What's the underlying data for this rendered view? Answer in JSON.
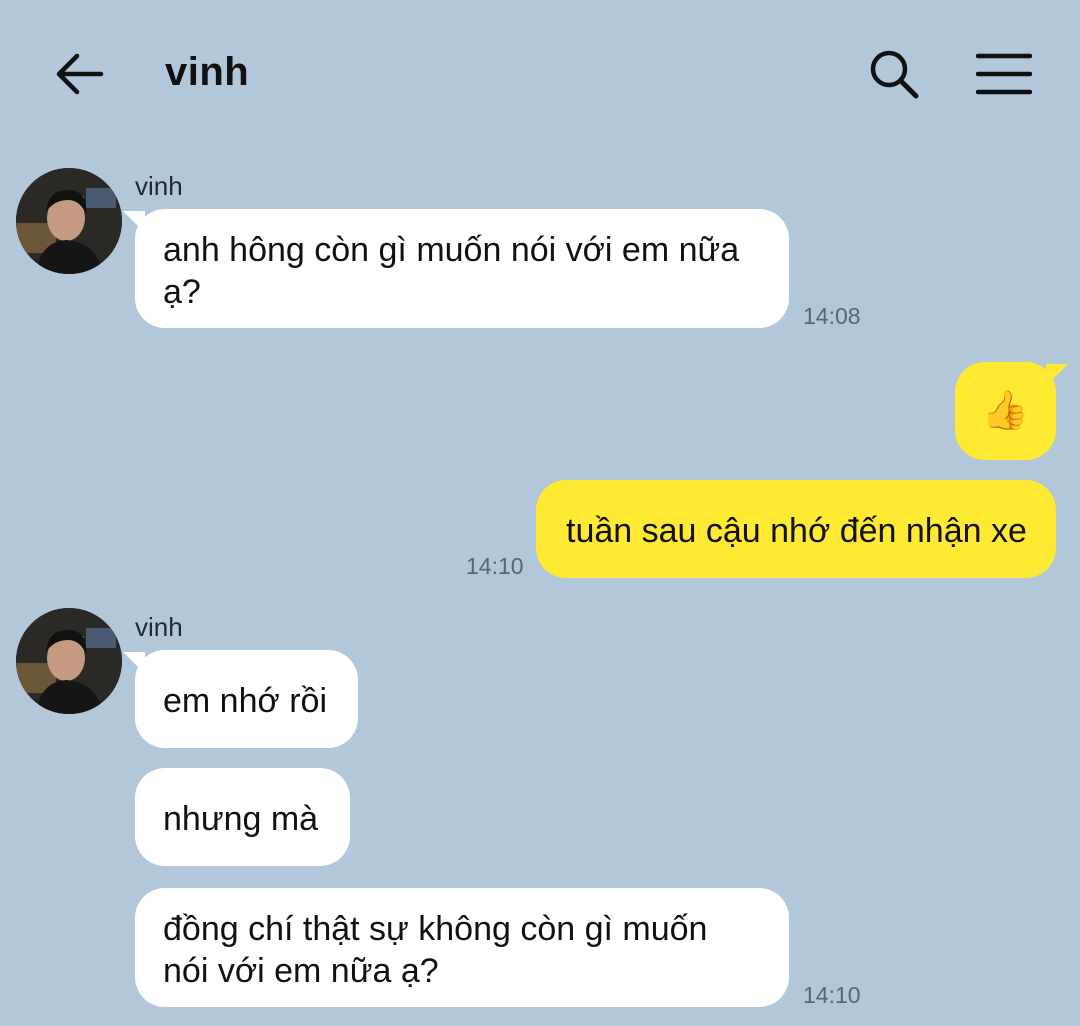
{
  "header": {
    "title": "vinh",
    "back_icon": "arrow-left-icon",
    "search_icon": "search-icon",
    "menu_icon": "hamburger-menu-icon"
  },
  "colors": {
    "background": "#b2c7da",
    "incoming_bubble": "#ffffff",
    "outgoing_bubble": "#fee933"
  },
  "messages": [
    {
      "sender": "vinh",
      "text": "anh hông còn gì muốn nói với em nữa ạ?",
      "time": "14:08"
    },
    {
      "sender": "me",
      "text": "👍",
      "emoji_name": "thumbs-up-icon"
    },
    {
      "sender": "me",
      "text": "tuần sau cậu nhớ đến nhận xe",
      "time": "14:10"
    },
    {
      "sender": "vinh",
      "text": "em nhớ rồi"
    },
    {
      "sender": "vinh",
      "text": "nhưng mà"
    },
    {
      "sender": "vinh",
      "text": "đồng chí thật sự không còn gì muốn nói với em nữa ạ?",
      "time": "14:10"
    }
  ]
}
